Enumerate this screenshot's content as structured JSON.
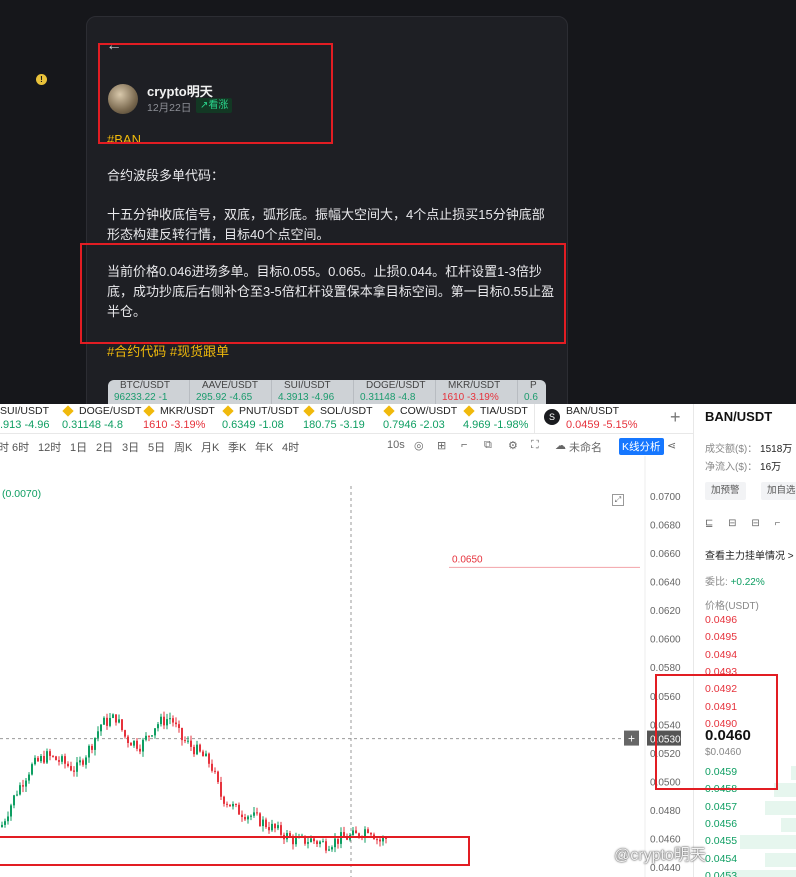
{
  "post": {
    "back_icon": "←",
    "author": "crypto明天",
    "date": "12月22日",
    "sentiment": "↗看涨",
    "hashtag": "#BAN",
    "p1": "合约波段多单代码：",
    "p2": "十五分钟收底信号，双底，弧形底。振幅大空间大，4个点止损买15分钟底部形态构建反转行情，目标40个点空间。",
    "p3": "当前价格0.046进场多单。目标0.055。0.065。止损0.044。杠杆设置1-3倍抄底，成功抄底后右侧补仓至3-5倍杠杆设置保本拿目标空间。第一目标0.55止盈半仓。",
    "tags": "#合约代码 #现货跟单",
    "mini_tickers": [
      {
        "symbol": "BTC/USDT",
        "price": "96233.22 -1",
        "color": "#1c9b6e"
      },
      {
        "symbol": "AAVE/USDT",
        "price": "295.92 -4.65",
        "color": "#1c9b6e"
      },
      {
        "symbol": "SUI/USDT",
        "price": "4.3913 -4.96",
        "color": "#1c9b6e"
      },
      {
        "symbol": "DOGE/USDT",
        "price": "0.31148 -4.8",
        "color": "#1c9b6e"
      },
      {
        "symbol": "MKR/USDT",
        "price": "1610 -3.19%",
        "color": "#e6323c"
      },
      {
        "symbol": "P",
        "price": "0.6",
        "color": "#1c9b6e"
      }
    ]
  },
  "tickers": [
    {
      "symbol": "SUI/USDT",
      "price": ".913 -4.96",
      "color": "#0e9e62"
    },
    {
      "symbol": "DOGE/USDT",
      "price": "0.31148 -4.8",
      "color": "#0e9e62"
    },
    {
      "symbol": "MKR/USDT",
      "price": "1610 -3.19%",
      "color": "#e6323c"
    },
    {
      "symbol": "PNUT/USDT",
      "price": "0.6349 -1.08",
      "color": "#0e9e62"
    },
    {
      "symbol": "SOL/USDT",
      "price": "180.75 -3.19",
      "color": "#0e9e62"
    },
    {
      "symbol": "COW/USDT",
      "price": "0.7946 -2.03",
      "color": "#0e9e62"
    },
    {
      "symbol": "TIA/USDT",
      "price": "4.969 -1.98%",
      "color": "#0e9e62"
    }
  ],
  "active_ticker": {
    "symbol": "BAN/USDT",
    "price": "0.0459 -5.15%"
  },
  "timeframes": [
    "时",
    "6时",
    "12时",
    "1日",
    "2日",
    "3日",
    "5日",
    "周K",
    "月K",
    "季K",
    "年K",
    "4时"
  ],
  "toolbar": {
    "interval": "10s",
    "layout": "未命名",
    "kline": "K线分析"
  },
  "chart": {
    "change_label": "(0.0070)",
    "target_label": "0.0650",
    "crosshair_label": "0.0530",
    "y_ticks": [
      "0.0700",
      "0.0680",
      "0.0660",
      "0.0640",
      "0.0620",
      "0.0600",
      "0.0580",
      "0.0560",
      "0.0540",
      "0.0520",
      "0.0500",
      "0.0480",
      "0.0460",
      "0.0440"
    ]
  },
  "chart_data": {
    "type": "candlestick",
    "ylim": [
      0.044,
      0.07
    ],
    "target_line": 0.065,
    "crosshair_price": 0.053,
    "trend": [
      [
        0,
        0.0468
      ],
      [
        15,
        0.0492
      ],
      [
        30,
        0.051
      ],
      [
        45,
        0.0518
      ],
      [
        60,
        0.0514
      ],
      [
        75,
        0.0508
      ],
      [
        90,
        0.0525
      ],
      [
        100,
        0.054
      ],
      [
        115,
        0.0545
      ],
      [
        125,
        0.053
      ],
      [
        140,
        0.0525
      ],
      [
        155,
        0.054
      ],
      [
        170,
        0.0545
      ],
      [
        180,
        0.053
      ],
      [
        195,
        0.0522
      ],
      [
        210,
        0.0512
      ],
      [
        220,
        0.049
      ],
      [
        235,
        0.048
      ],
      [
        250,
        0.0476
      ],
      [
        265,
        0.047
      ],
      [
        280,
        0.0464
      ],
      [
        295,
        0.0458
      ],
      [
        310,
        0.0459
      ],
      [
        325,
        0.0456
      ],
      [
        340,
        0.046
      ],
      [
        355,
        0.0462
      ],
      [
        368,
        0.0468
      ],
      [
        378,
        0.0458
      ],
      [
        385,
        0.046
      ]
    ]
  },
  "sidebar": {
    "pair": "BAN/USDT",
    "volume": "成交额($)：",
    "volume_val": "1518万",
    "inflow": "净流入($)：",
    "inflow_val": "16万",
    "btn_watch": "加预警",
    "btn_fav": "加自选",
    "ob_link": "查看主力挂单情况 >",
    "ratio_label": "委比:",
    "ratio_val": "+0.22%",
    "price_header": "价格(USDT)",
    "asks": [
      "0.0496",
      "0.0495",
      "0.0494",
      "0.0493",
      "0.0492",
      "0.0491",
      "0.0490"
    ],
    "last": "0.0460",
    "last_usd": "$0.0460",
    "bids": [
      "0.0459",
      "0.0458",
      "0.0457",
      "0.0456",
      "0.0455",
      "0.0454",
      "0.0453"
    ],
    "icons": "⊑ ⊟ ⊟ ⌐"
  },
  "watermark": "@crypto明天",
  "colors": {
    "up": "#0e9e62",
    "down": "#e6323c",
    "annotation": "#e21d23",
    "hashtag": "#f0b90b"
  }
}
